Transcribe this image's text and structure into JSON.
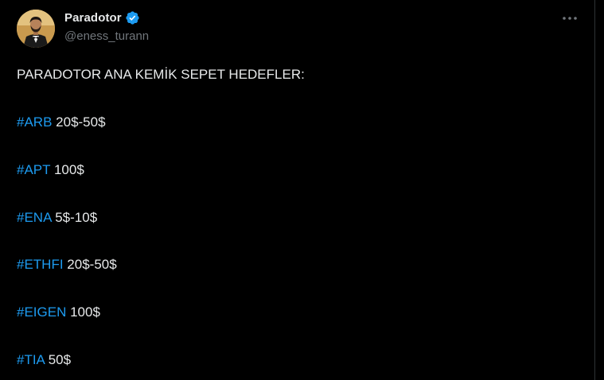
{
  "author": {
    "display_name": "Paradotor",
    "handle": "@eness_turann",
    "verified": true,
    "avatar_icon": "profile-photo"
  },
  "menu": {
    "more_icon": "more-horizontal-icon"
  },
  "tweet": {
    "headline": "PARADOTOR ANA KEMİK SEPET HEDEFLER:",
    "targets": [
      {
        "hashtag": "#ARB",
        "value": "20$-50$"
      },
      {
        "hashtag": "#APT",
        "value": "100$"
      },
      {
        "hashtag": "#ENA",
        "value": "5$-10$"
      },
      {
        "hashtag": "#ETHFI",
        "value": "20$-50$"
      },
      {
        "hashtag": "#EIGEN",
        "value": "100$"
      },
      {
        "hashtag": "#TIA",
        "value": "50$"
      }
    ]
  },
  "colors": {
    "background": "#000000",
    "text": "#e7e9ea",
    "secondary_text": "#71767b",
    "hashtag": "#1d9bf0",
    "verified_badge": "#1d9bf0"
  }
}
